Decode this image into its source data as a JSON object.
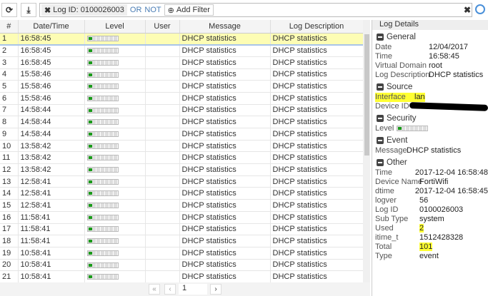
{
  "toolbar": {
    "refresh_icon": "refresh-icon",
    "download_icon": "download-icon",
    "filter_chip": "Log ID: 0100026003",
    "or_label": "OR",
    "not_label": "NOT",
    "add_filter": "Add Filter"
  },
  "columns": [
    "#",
    "Date/Time",
    "Level",
    "User",
    "Message",
    "Log Description"
  ],
  "rows": [
    [
      "1",
      "16:58:45",
      "",
      "DHCP statistics",
      "DHCP statistics"
    ],
    [
      "2",
      "16:58:45",
      "",
      "DHCP statistics",
      "DHCP statistics"
    ],
    [
      "3",
      "16:58:45",
      "",
      "DHCP statistics",
      "DHCP statistics"
    ],
    [
      "4",
      "15:58:46",
      "",
      "DHCP statistics",
      "DHCP statistics"
    ],
    [
      "5",
      "15:58:46",
      "",
      "DHCP statistics",
      "DHCP statistics"
    ],
    [
      "6",
      "15:58:46",
      "",
      "DHCP statistics",
      "DHCP statistics"
    ],
    [
      "7",
      "14:58:44",
      "",
      "DHCP statistics",
      "DHCP statistics"
    ],
    [
      "8",
      "14:58:44",
      "",
      "DHCP statistics",
      "DHCP statistics"
    ],
    [
      "9",
      "14:58:44",
      "",
      "DHCP statistics",
      "DHCP statistics"
    ],
    [
      "10",
      "13:58:42",
      "",
      "DHCP statistics",
      "DHCP statistics"
    ],
    [
      "11",
      "13:58:42",
      "",
      "DHCP statistics",
      "DHCP statistics"
    ],
    [
      "12",
      "13:58:42",
      "",
      "DHCP statistics",
      "DHCP statistics"
    ],
    [
      "13",
      "12:58:41",
      "",
      "DHCP statistics",
      "DHCP statistics"
    ],
    [
      "14",
      "12:58:41",
      "",
      "DHCP statistics",
      "DHCP statistics"
    ],
    [
      "15",
      "12:58:41",
      "",
      "DHCP statistics",
      "DHCP statistics"
    ],
    [
      "16",
      "11:58:41",
      "",
      "DHCP statistics",
      "DHCP statistics"
    ],
    [
      "17",
      "11:58:41",
      "",
      "DHCP statistics",
      "DHCP statistics"
    ],
    [
      "18",
      "11:58:41",
      "",
      "DHCP statistics",
      "DHCP statistics"
    ],
    [
      "19",
      "10:58:41",
      "",
      "DHCP statistics",
      "DHCP statistics"
    ],
    [
      "20",
      "10:58:41",
      "",
      "DHCP statistics",
      "DHCP statistics"
    ],
    [
      "21",
      "10:58:41",
      "",
      "DHCP statistics",
      "DHCP statistics"
    ]
  ],
  "pagination": {
    "page": "1"
  },
  "details": {
    "title": "Log Details",
    "sections": [
      {
        "name": "General",
        "items": [
          [
            "Date",
            "12/04/2017"
          ],
          [
            "Time",
            "16:58:45"
          ],
          [
            "Virtual Domain",
            "root"
          ],
          [
            "Log Description",
            "DHCP statistics"
          ]
        ]
      },
      {
        "name": "Source",
        "items": [
          [
            "Interface",
            "lan"
          ],
          [
            "Device ID",
            ""
          ]
        ]
      },
      {
        "name": "Security",
        "items": [
          [
            "Level",
            ""
          ]
        ]
      },
      {
        "name": "Event",
        "items": [
          [
            "Message",
            "DHCP statistics"
          ]
        ]
      },
      {
        "name": "Other",
        "items": [
          [
            "Time",
            "2017-12-04 16:58:48"
          ],
          [
            "Device Name",
            "FortiWifi"
          ],
          [
            "dtime",
            "2017-12-04 16:58:45"
          ],
          [
            "logver",
            "56"
          ],
          [
            "Log ID",
            "0100026003"
          ],
          [
            "Sub Type",
            "system"
          ],
          [
            "Used",
            "2"
          ],
          [
            "itime_t",
            "1512428328"
          ],
          [
            "Total",
            "101"
          ],
          [
            "Type",
            "event"
          ]
        ]
      }
    ]
  },
  "colors": {
    "selected_row": "#fdfdb4",
    "highlight": "#ffff33",
    "level_green": "#1a9a1a"
  }
}
